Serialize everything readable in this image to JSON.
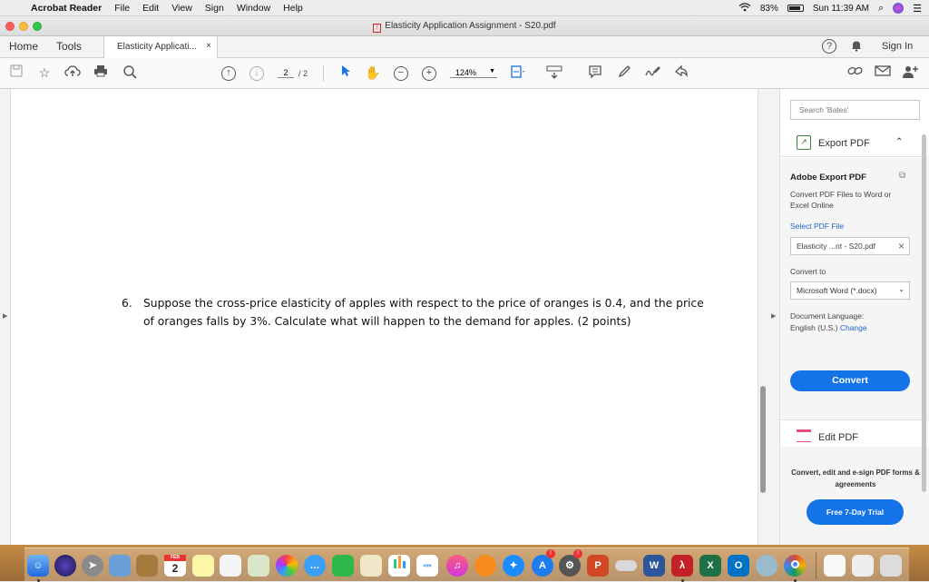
{
  "menubar": {
    "app_name": "Acrobat Reader",
    "items": [
      "File",
      "Edit",
      "View",
      "Sign",
      "Window",
      "Help"
    ],
    "battery": "83%",
    "clock": "Sun 11:39 AM"
  },
  "window": {
    "title": "Elasticity Application Assignment - S20.pdf"
  },
  "tabs": {
    "home": "Home",
    "tools": "Tools",
    "document": "Elasticity Applicati...",
    "close": "×",
    "help": "?",
    "sign_in": "Sign In"
  },
  "toolbar": {
    "page_current": "2",
    "page_total": "/ 2",
    "zoom": "124%"
  },
  "document": {
    "question_number": "6.",
    "question_text": "Suppose the cross-price elasticity of apples with respect to the price of oranges is 0.4, and the price of oranges falls by 3%. Calculate what will happen to the demand for apples. (2 points)"
  },
  "right_panel": {
    "search_placeholder": "Search 'Bates'",
    "export_label": "Export PDF",
    "adobe_export_title": "Adobe Export PDF",
    "adobe_export_desc": "Convert PDF Files to Word or Excel Online",
    "select_file_label": "Select PDF File",
    "selected_file": "Elasticity ...nt - S20.pdf",
    "convert_to_label": "Convert to",
    "convert_to_value": "Microsoft Word (*.docx)",
    "doc_language_label": "Document Language:",
    "doc_language_value": "English (U.S.)",
    "change_link": "Change",
    "convert_button": "Convert",
    "edit_pdf_label": "Edit PDF",
    "promo_text": "Convert, edit and e-sign PDF forms & agreements",
    "trial_button": "Free 7-Day Trial"
  },
  "dock": {
    "calendar_day": "2",
    "calendar_month": "FEB"
  },
  "colors": {
    "accent_blue": "#1473e6",
    "link_blue": "#2266cc",
    "edit_pink": "#e0507a"
  }
}
